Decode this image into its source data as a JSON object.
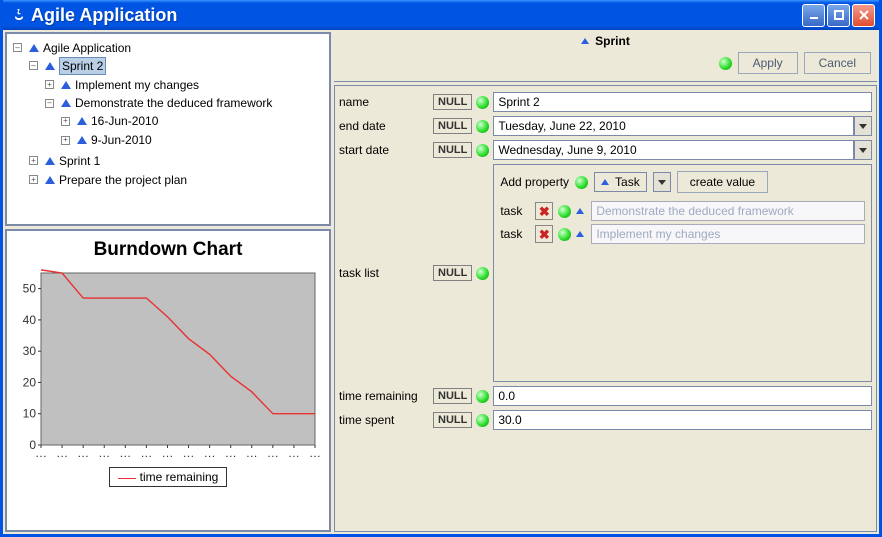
{
  "window": {
    "title": "Agile Application"
  },
  "tree": {
    "root": "Agile Application",
    "sprint2": {
      "label": "Sprint 2",
      "tasks": [
        {
          "label": "Implement my changes"
        },
        {
          "label": "Demonstrate the deduced framework",
          "dates": [
            "16-Jun-2010",
            "9-Jun-2010"
          ]
        }
      ]
    },
    "sprint1": {
      "label": "Sprint 1"
    },
    "prepare": {
      "label": "Prepare the project plan"
    }
  },
  "chart_data": {
    "type": "line",
    "title": "Burndown Chart",
    "xlabel": "",
    "ylabel": "",
    "ylim": [
      0,
      55
    ],
    "x": [
      0,
      1,
      2,
      3,
      4,
      5,
      6,
      7,
      8,
      9,
      10,
      11,
      12,
      13
    ],
    "series": [
      {
        "name": "time remaining",
        "values": [
          56,
          55,
          47,
          47,
          47,
          47,
          41,
          34,
          29,
          22,
          17,
          10,
          10,
          10
        ]
      }
    ],
    "legend": {
      "0": "time remaining"
    }
  },
  "editor": {
    "title": "Sprint",
    "buttons": {
      "apply": "Apply",
      "cancel": "Cancel"
    },
    "null_label": "NULL",
    "fields": {
      "name": {
        "label": "name",
        "value": "Sprint 2"
      },
      "end_date": {
        "label": "end date",
        "value": "Tuesday, June 22, 2010"
      },
      "start_date": {
        "label": "start date",
        "value": "Wednesday, June 9, 2010"
      },
      "task_list": {
        "label": "task list"
      },
      "time_remaining": {
        "label": "time remaining",
        "value": "0.0"
      },
      "time_spent": {
        "label": "time spent",
        "value": "30.0"
      }
    },
    "task_box": {
      "add_label": "Add property",
      "type": "Task",
      "create_btn": "create value",
      "tasks": [
        {
          "label": "task",
          "value": "Demonstrate the deduced framework"
        },
        {
          "label": "task",
          "value": "Implement my changes"
        }
      ]
    }
  }
}
